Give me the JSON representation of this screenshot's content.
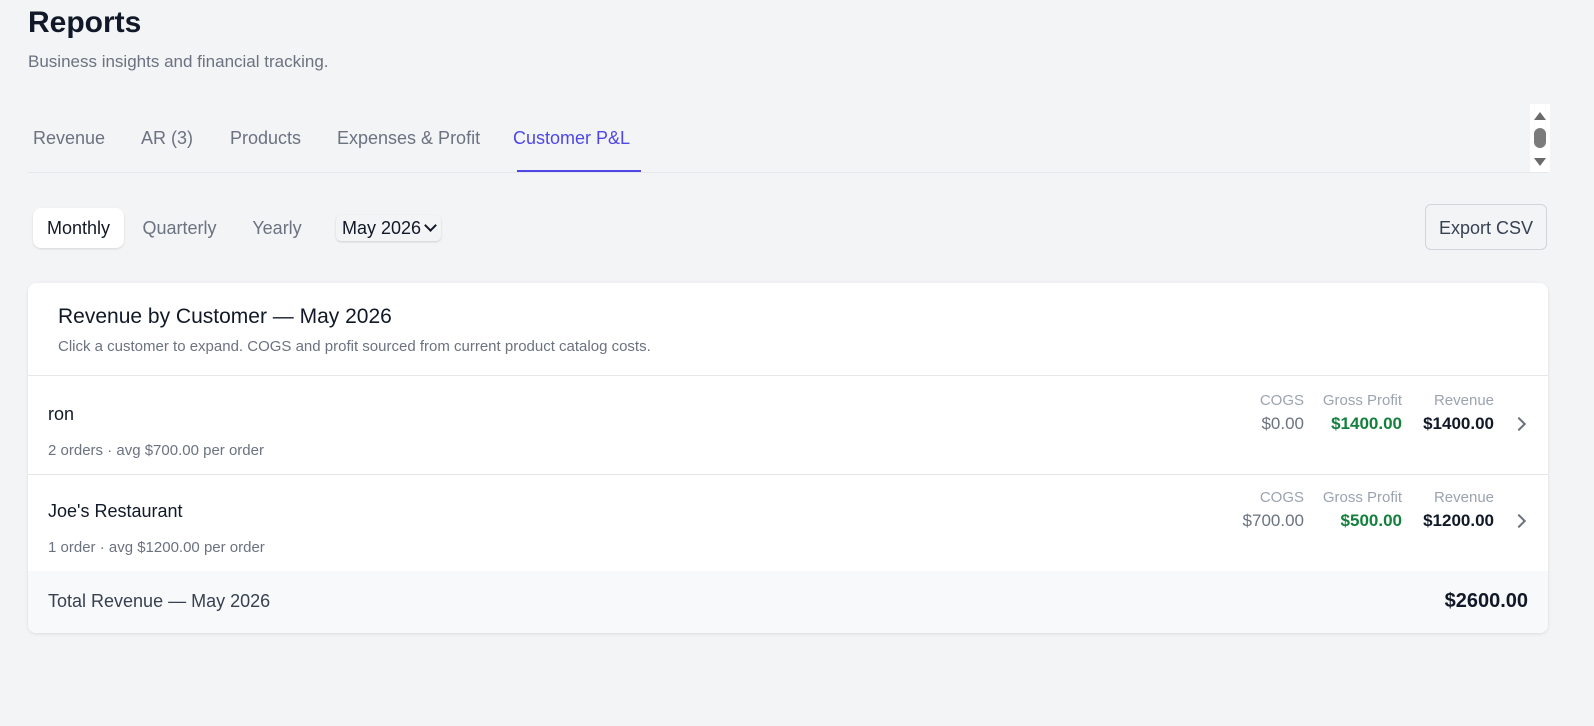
{
  "page": {
    "title": "Reports",
    "subtitle": "Business insights and financial tracking."
  },
  "tabs": [
    {
      "label": "Revenue",
      "active": false
    },
    {
      "label": "AR (3)",
      "active": false
    },
    {
      "label": "Products",
      "active": false
    },
    {
      "label": "Expenses & Profit",
      "active": false
    },
    {
      "label": "Customer P&L",
      "active": true
    }
  ],
  "period": {
    "options": [
      "Monthly",
      "Quarterly",
      "Yearly"
    ],
    "selected": "Monthly",
    "month_value": "May 2026"
  },
  "export_label": "Export CSV",
  "card": {
    "title": "Revenue by Customer — May 2026",
    "description": "Click a customer to expand. COGS and profit sourced from current product catalog costs."
  },
  "metric_labels": {
    "cogs": "COGS",
    "gross_profit": "Gross Profit",
    "revenue": "Revenue"
  },
  "customers": [
    {
      "name": "ron",
      "meta": "2 orders · avg $700.00 per order",
      "cogs": "$0.00",
      "gross_profit": "$1400.00",
      "revenue": "$1400.00"
    },
    {
      "name": "Joe's Restaurant",
      "meta": "1 order · avg $1200.00 per order",
      "cogs": "$700.00",
      "gross_profit": "$500.00",
      "revenue": "$1200.00"
    }
  ],
  "total": {
    "label": "Total Revenue — May 2026",
    "value": "$2600.00"
  },
  "colors": {
    "accent": "#4f46e5",
    "profit": "#15803d",
    "background": "#f3f4f6"
  }
}
